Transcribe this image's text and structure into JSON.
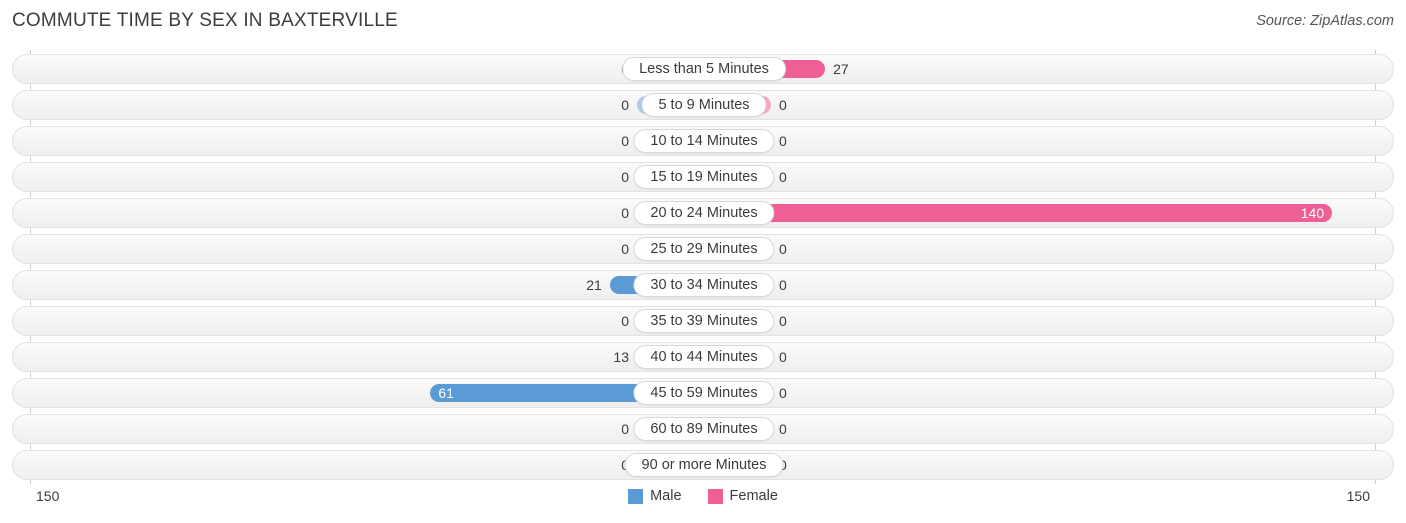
{
  "header": {
    "title": "COMMUTE TIME BY SEX IN BAXTERVILLE",
    "source": "Source: ZipAtlas.com"
  },
  "axis": {
    "left_end_label": "150",
    "right_end_label": "150",
    "max": 150
  },
  "legend": [
    {
      "label": "Male",
      "color": "#5b9bd5"
    },
    {
      "label": "Female",
      "color": "#ef5f96"
    }
  ],
  "colors": {
    "male_strong": "#5b9bd5",
    "male_light": "#aecbeb",
    "female_strong": "#ef5f96",
    "female_light": "#f7a8c4",
    "row_border": "#e2e2e2",
    "axis_line": "#cfcfcf",
    "text": "#3c3c3c"
  },
  "chart_data": {
    "type": "bar",
    "subtype": "diverging-tornado",
    "title": "COMMUTE TIME BY SEX IN BAXTERVILLE",
    "xlabel": "",
    "ylabel": "",
    "xlim": [
      -150,
      150
    ],
    "axis_max_per_side": 150,
    "grid": false,
    "legend_position": "bottom-center",
    "categories": [
      "Less than 5 Minutes",
      "5 to 9 Minutes",
      "10 to 14 Minutes",
      "15 to 19 Minutes",
      "20 to 24 Minutes",
      "25 to 29 Minutes",
      "30 to 34 Minutes",
      "35 to 39 Minutes",
      "40 to 44 Minutes",
      "45 to 59 Minutes",
      "60 to 89 Minutes",
      "90 or more Minutes"
    ],
    "series": [
      {
        "name": "Male",
        "direction": "left",
        "values": [
          0,
          0,
          0,
          0,
          0,
          0,
          21,
          0,
          13,
          61,
          0,
          0
        ]
      },
      {
        "name": "Female",
        "direction": "right",
        "values": [
          27,
          0,
          0,
          0,
          140,
          0,
          0,
          0,
          0,
          0,
          0,
          0
        ]
      }
    ]
  },
  "rows": [
    {
      "category": "Less than 5 Minutes",
      "male": "0",
      "female": "27"
    },
    {
      "category": "5 to 9 Minutes",
      "male": "0",
      "female": "0"
    },
    {
      "category": "10 to 14 Minutes",
      "male": "0",
      "female": "0"
    },
    {
      "category": "15 to 19 Minutes",
      "male": "0",
      "female": "0"
    },
    {
      "category": "20 to 24 Minutes",
      "male": "0",
      "female": "140"
    },
    {
      "category": "25 to 29 Minutes",
      "male": "0",
      "female": "0"
    },
    {
      "category": "30 to 34 Minutes",
      "male": "21",
      "female": "0"
    },
    {
      "category": "35 to 39 Minutes",
      "male": "0",
      "female": "0"
    },
    {
      "category": "40 to 44 Minutes",
      "male": "13",
      "female": "0"
    },
    {
      "category": "45 to 59 Minutes",
      "male": "61",
      "female": "0"
    },
    {
      "category": "60 to 89 Minutes",
      "male": "0",
      "female": "0"
    },
    {
      "category": "90 or more Minutes",
      "male": "0",
      "female": "0"
    }
  ]
}
